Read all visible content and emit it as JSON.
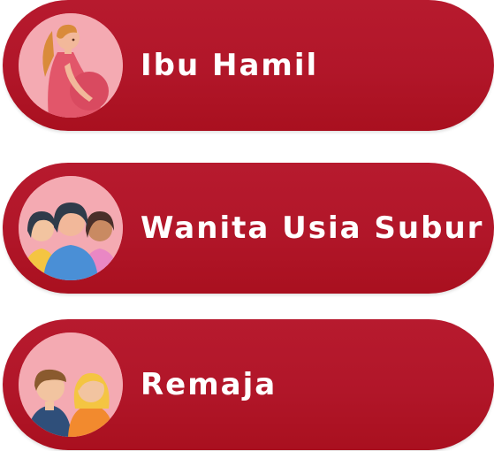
{
  "colors": {
    "button_bg": "#b11629",
    "avatar_bg": "#f4aab2",
    "label_text": "#ffffff"
  },
  "menu": {
    "items": [
      {
        "label": "Ibu Hamil",
        "icon": "pregnant-woman-icon"
      },
      {
        "label": "Wanita Usia Subur",
        "icon": "women-group-icon"
      },
      {
        "label": "Remaja",
        "icon": "teenagers-icon"
      }
    ]
  }
}
